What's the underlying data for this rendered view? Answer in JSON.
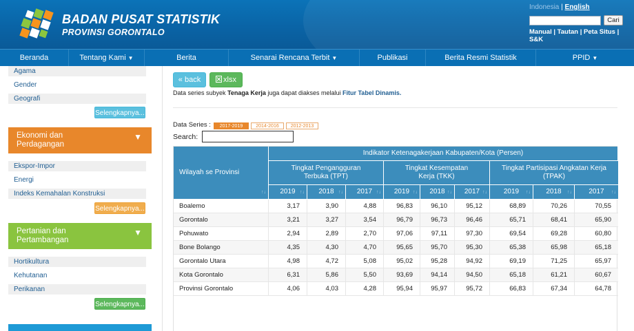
{
  "header": {
    "title": "BADAN PUSAT STATISTIK",
    "subtitle": "PROVINSI GORONTALO",
    "lang_id": "Indonesia",
    "lang_sep": " | ",
    "lang_en": "English",
    "search_button": "Cari",
    "links": "Manual | Tautan | Peta Situs | S&K"
  },
  "nav": [
    {
      "label": "Beranda",
      "caret": ""
    },
    {
      "label": "Tentang Kami",
      "caret": "▼"
    },
    {
      "label": "Berita",
      "caret": ""
    },
    {
      "label": "Senarai Rencana Terbit",
      "caret": "▼"
    },
    {
      "label": "Publikasi",
      "caret": ""
    },
    {
      "label": "Berita Resmi Statistik",
      "caret": ""
    },
    {
      "label": "PPID",
      "caret": "▼"
    }
  ],
  "sidebar": {
    "top_items": [
      "Agama",
      "Gender",
      "Geografi"
    ],
    "more_label": "Selengkapnya...",
    "cat1": {
      "title_line1": "Ekonomi dan",
      "title_line2": "Perdagangan",
      "items": [
        "Ekspor-Impor",
        "Energi",
        "Indeks Kemahalan Konstruksi"
      ]
    },
    "cat2": {
      "title_line1": "Pertanian dan",
      "title_line2": "Pertambangan",
      "items": [
        "Hortikultura",
        "Kehutanan",
        "Perikanan"
      ]
    },
    "triangle": "▼"
  },
  "main": {
    "back_label": "« back",
    "xlsx_label": "xlsx",
    "note_prefix": "Data series subyek ",
    "note_subject": "Tenaga Kerja",
    "note_mid": " juga dapat diakses melalui ",
    "note_link": "Fitur Tabel Dinamis.",
    "dataseries_label": "Data Series :",
    "dataseries_tabs": [
      "2017-2019",
      "2014-2016",
      "2012-2013"
    ],
    "search_label": "Search:"
  },
  "table": {
    "col_region": "Wilayah se Provinsi",
    "group_header": "Indikator Ketenagakerjaan Kabupaten/Kota (Persen)",
    "subgroups": [
      "Tingkat Pengangguran Terbuka (TPT)",
      "Tingkat Kesempatan Kerja (TKK)",
      "Tingkat Partisipasi Angkatan Kerja (TPAK)"
    ],
    "years": [
      "2019",
      "2018",
      "2017"
    ],
    "sort_icon": "↑↓",
    "rows": [
      {
        "name": "Boalemo",
        "values": [
          "3,17",
          "3,90",
          "4,88",
          "96,83",
          "96,10",
          "95,12",
          "68,89",
          "70,26",
          "70,55"
        ]
      },
      {
        "name": "Gorontalo",
        "values": [
          "3,21",
          "3,27",
          "3,54",
          "96,79",
          "96,73",
          "96,46",
          "65,71",
          "68,41",
          "65,90"
        ]
      },
      {
        "name": "Pohuwato",
        "values": [
          "2,94",
          "2,89",
          "2,70",
          "97,06",
          "97,11",
          "97,30",
          "69,54",
          "69,28",
          "60,80"
        ]
      },
      {
        "name": "Bone Bolango",
        "values": [
          "4,35",
          "4,30",
          "4,70",
          "95,65",
          "95,70",
          "95,30",
          "65,38",
          "65,98",
          "65,18"
        ]
      },
      {
        "name": "Gorontalo Utara",
        "values": [
          "4,98",
          "4,72",
          "5,08",
          "95,02",
          "95,28",
          "94,92",
          "69,19",
          "71,25",
          "65,97"
        ]
      },
      {
        "name": "Kota Gorontalo",
        "values": [
          "6,31",
          "5,86",
          "5,50",
          "93,69",
          "94,14",
          "94,50",
          "65,18",
          "61,21",
          "60,67"
        ]
      },
      {
        "name": "Provinsi Gorontalo",
        "values": [
          "4,06",
          "4,03",
          "4,28",
          "95,94",
          "95,97",
          "95,72",
          "66,83",
          "67,34",
          "64,78"
        ]
      }
    ]
  },
  "colors": {
    "header_blue": "#0a64a6",
    "nav_blue": "#0a6fb4",
    "table_header": "#3c8dbc",
    "orange": "#e8872b",
    "green": "#8ac43f",
    "info": "#5bc0de",
    "success": "#5cb85c",
    "warning": "#f0ad4e"
  },
  "icons": [
    "bps-logo",
    "excel-icon",
    "caret-down-icon",
    "sort-icon"
  ]
}
